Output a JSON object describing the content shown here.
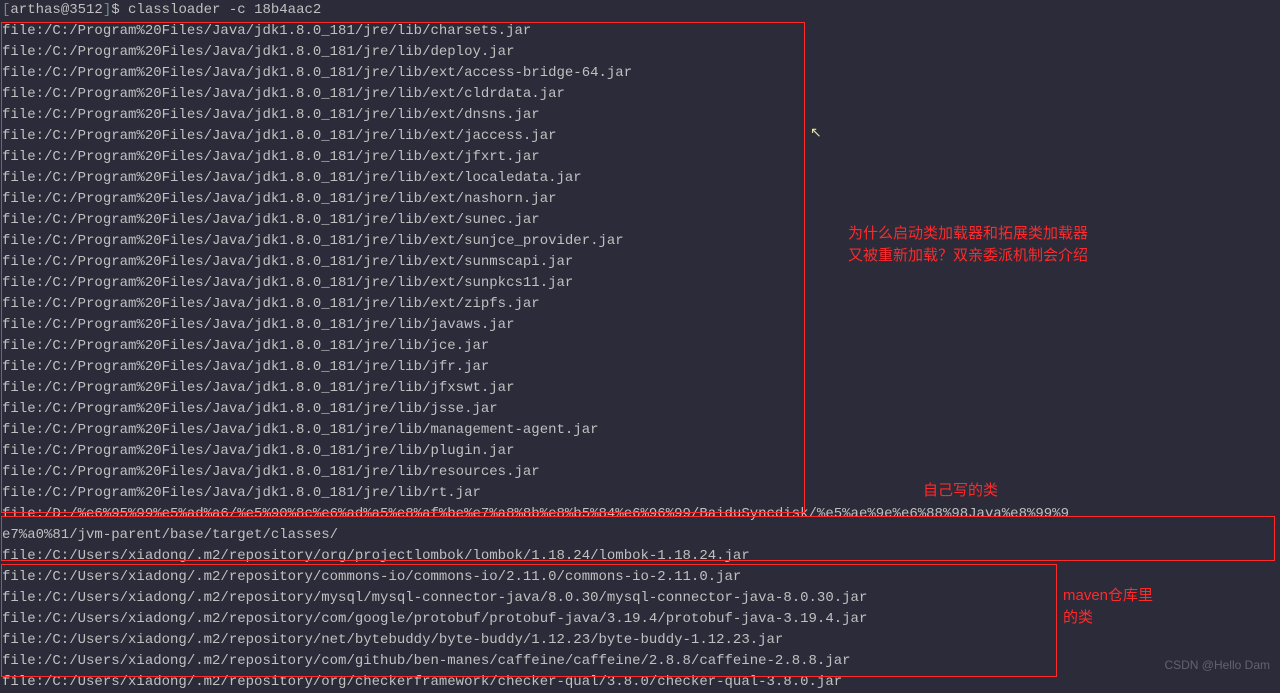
{
  "prompt": {
    "bracket_open": "[",
    "user_host": "arthas@3512",
    "bracket_close": "]",
    "symbol": "$",
    "command": "classloader -c 18b4aac2"
  },
  "lines_group1": [
    "file:/C:/Program%20Files/Java/jdk1.8.0_181/jre/lib/charsets.jar",
    "file:/C:/Program%20Files/Java/jdk1.8.0_181/jre/lib/deploy.jar",
    "file:/C:/Program%20Files/Java/jdk1.8.0_181/jre/lib/ext/access-bridge-64.jar",
    "file:/C:/Program%20Files/Java/jdk1.8.0_181/jre/lib/ext/cldrdata.jar",
    "file:/C:/Program%20Files/Java/jdk1.8.0_181/jre/lib/ext/dnsns.jar",
    "file:/C:/Program%20Files/Java/jdk1.8.0_181/jre/lib/ext/jaccess.jar",
    "file:/C:/Program%20Files/Java/jdk1.8.0_181/jre/lib/ext/jfxrt.jar",
    "file:/C:/Program%20Files/Java/jdk1.8.0_181/jre/lib/ext/localedata.jar",
    "file:/C:/Program%20Files/Java/jdk1.8.0_181/jre/lib/ext/nashorn.jar",
    "file:/C:/Program%20Files/Java/jdk1.8.0_181/jre/lib/ext/sunec.jar",
    "file:/C:/Program%20Files/Java/jdk1.8.0_181/jre/lib/ext/sunjce_provider.jar",
    "file:/C:/Program%20Files/Java/jdk1.8.0_181/jre/lib/ext/sunmscapi.jar",
    "file:/C:/Program%20Files/Java/jdk1.8.0_181/jre/lib/ext/sunpkcs11.jar",
    "file:/C:/Program%20Files/Java/jdk1.8.0_181/jre/lib/ext/zipfs.jar",
    "file:/C:/Program%20Files/Java/jdk1.8.0_181/jre/lib/javaws.jar",
    "file:/C:/Program%20Files/Java/jdk1.8.0_181/jre/lib/jce.jar",
    "file:/C:/Program%20Files/Java/jdk1.8.0_181/jre/lib/jfr.jar",
    "file:/C:/Program%20Files/Java/jdk1.8.0_181/jre/lib/jfxswt.jar",
    "file:/C:/Program%20Files/Java/jdk1.8.0_181/jre/lib/jsse.jar",
    "file:/C:/Program%20Files/Java/jdk1.8.0_181/jre/lib/management-agent.jar",
    "file:/C:/Program%20Files/Java/jdk1.8.0_181/jre/lib/plugin.jar",
    "file:/C:/Program%20Files/Java/jdk1.8.0_181/jre/lib/resources.jar",
    "file:/C:/Program%20Files/Java/jdk1.8.0_181/jre/lib/rt.jar"
  ],
  "lines_group2": [
    "file:/D:/%e6%95%99%e5%ad%a6/%e5%90%8c%e6%ad%a5%e8%af%be%e7%a8%8b%e8%b5%84%e6%96%99/BaiduSyncdisk/%e5%ae%9e%e6%88%98Java%e8%99%9",
    "e7%a0%81/jvm-parent/base/target/classes/"
  ],
  "lines_group3": [
    "file:/C:/Users/xiadong/.m2/repository/org/projectlombok/lombok/1.18.24/lombok-1.18.24.jar",
    "file:/C:/Users/xiadong/.m2/repository/commons-io/commons-io/2.11.0/commons-io-2.11.0.jar",
    "file:/C:/Users/xiadong/.m2/repository/mysql/mysql-connector-java/8.0.30/mysql-connector-java-8.0.30.jar",
    "file:/C:/Users/xiadong/.m2/repository/com/google/protobuf/protobuf-java/3.19.4/protobuf-java-3.19.4.jar",
    "file:/C:/Users/xiadong/.m2/repository/net/bytebuddy/byte-buddy/1.12.23/byte-buddy-1.12.23.jar",
    "file:/C:/Users/xiadong/.m2/repository/com/github/ben-manes/caffeine/caffeine/2.8.8/caffeine-2.8.8.jar",
    "file:/C:/Users/xiadong/.m2/repository/org/checkerframework/checker-qual/3.8.0/checker-qual-3.8.0.jar"
  ],
  "annotations": {
    "right1_line1": "为什么启动类加载器和拓展类加载器",
    "right1_line2": "又被重新加载？双亲委派机制会介绍",
    "right2": "自己写的类",
    "right3_line1": "maven仓库里",
    "right3_line2": "的类"
  },
  "watermark": "CSDN @Hello Dam"
}
